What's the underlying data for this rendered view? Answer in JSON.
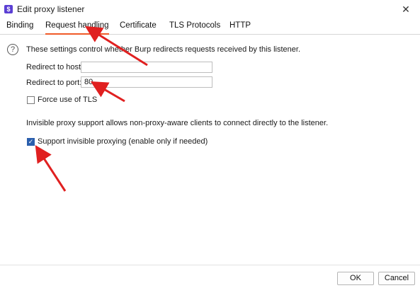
{
  "window": {
    "title": "Edit proxy listener",
    "close_glyph": "✕",
    "app_icon_glyph": "$"
  },
  "tabs": [
    {
      "label": "Binding",
      "active": false
    },
    {
      "label": "Request handling",
      "active": true
    },
    {
      "label": "Certificate",
      "active": false
    },
    {
      "label": "TLS Protocols",
      "active": false
    },
    {
      "label": "HTTP",
      "active": false
    }
  ],
  "request_handling": {
    "help_glyph": "?",
    "description": "These settings control whether Burp redirects requests received by this listener.",
    "redirect_host_label": "Redirect to host:",
    "redirect_host_value": "",
    "redirect_port_label": "Redirect to port:",
    "redirect_port_value": "80",
    "force_tls_label": "Force use of TLS",
    "force_tls_checked": false,
    "invisible_info": "Invisible proxy support allows non-proxy-aware clients to connect directly to the listener.",
    "invisible_label": "Support invisible proxying (enable only if needed)",
    "invisible_checked": true,
    "check_glyph": "✓"
  },
  "buttons": {
    "ok": "OK",
    "cancel": "Cancel"
  },
  "colors": {
    "accent_tab": "#f05a28",
    "annotation_arrow": "#e02020",
    "checkbox_checked": "#2b5fad"
  }
}
